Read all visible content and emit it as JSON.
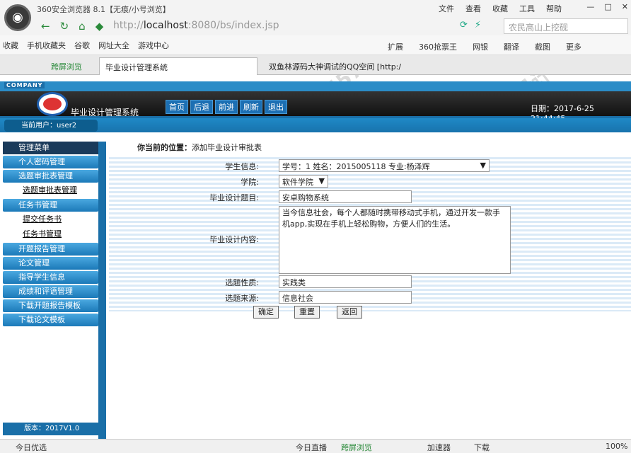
{
  "browser": {
    "title": "360安全浏览器 8.1【无痕/小号浏览】",
    "menus": [
      "文件",
      "查看",
      "收藏",
      "工具",
      "帮助"
    ],
    "url_prefix": "http://",
    "url_host": "localhost",
    "url_rest": ":8080/bs/index.jsp",
    "search_placeholder": "农民高山上挖砚",
    "favorites": [
      "收藏",
      "手机收藏夹",
      "谷歌",
      "网址大全",
      "游戏中心"
    ],
    "fav_right": [
      "扩展",
      "360抢票王",
      "网银",
      "翻译",
      "截图",
      "更多"
    ],
    "tabs": [
      "跨屏浏览",
      "毕业设计管理系统",
      "双鱼林源码大神调试的QQ空间 [http:/"
    ]
  },
  "app": {
    "company": "COMPANY",
    "name": "毕业设计管理系统",
    "header_buttons": [
      "首页",
      "后退",
      "前进",
      "刷新",
      "退出"
    ],
    "date": "日期：2017-6-25 21:44:45",
    "current_user": "当前用户：user2",
    "menu_title": "管理菜单",
    "version": "版本：2017V1.0"
  },
  "sidebar": [
    {
      "label": "个人密码管理"
    },
    {
      "label": "选题审批表管理",
      "subs": [
        "选题审批表管理"
      ]
    },
    {
      "label": "任务书管理",
      "subs": [
        "提交任务书",
        "任务书管理"
      ]
    },
    {
      "label": "开题报告管理"
    },
    {
      "label": "论文管理"
    },
    {
      "label": "指导学生信息"
    },
    {
      "label": "成绩和评语管理"
    },
    {
      "label": "下载开题报告模板"
    },
    {
      "label": "下载论文模板"
    }
  ],
  "breadcrumb": {
    "prefix": "你当前的位置：",
    "page": "添加毕业设计审批表"
  },
  "form": {
    "student_label": "学生信息:",
    "student_value": "学号：1   姓名：2015005118   专业:杨泽辉",
    "college_label": "学院:",
    "college_value": "软件学院",
    "topic_label": "毕业设计题目:",
    "topic_value": "安卓购物系统",
    "content_label": "毕业设计内容:",
    "content_value": "当今信息社会，每个人都随时携带移动式手机，通过开发一款手机app,实现在手机上轻松购物，方便人们的生活。",
    "nature_label": "选题性质:",
    "nature_value": "实践类",
    "source_label": "选题来源:",
    "source_value": "信息社会",
    "ok": "确定",
    "reset": "重置",
    "back": "返回"
  },
  "statusbar": {
    "left": "今日优选",
    "items": [
      "今日直播",
      "跨屏浏览",
      "加速器",
      "下载"
    ],
    "zoom": "100%"
  },
  "watermarks": [
    "QQ:254540457",
    "常年售精品源码",
    "大神计算机设计"
  ]
}
